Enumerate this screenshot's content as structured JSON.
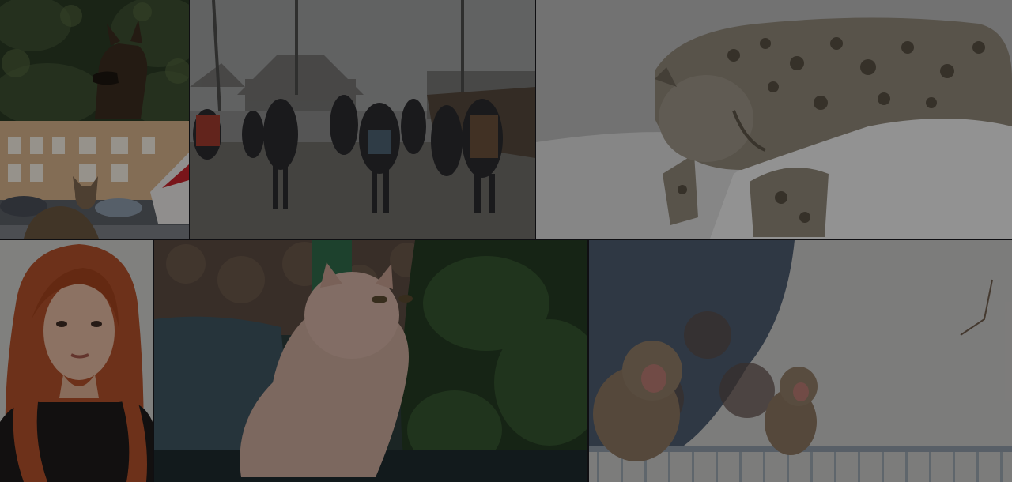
{
  "gallery": {
    "tiles": [
      {
        "id": "dog",
        "icon": "photo-dog-in-bushes"
      },
      {
        "id": "street-cat",
        "icon": "photo-cat-on-street"
      },
      {
        "id": "crowd",
        "icon": "photo-people-walking-in-rain"
      },
      {
        "id": "snow-leopard",
        "icon": "photo-snow-leopard"
      },
      {
        "id": "woman",
        "icon": "photo-red-haired-woman"
      },
      {
        "id": "persian-cat",
        "icon": "photo-persian-cat"
      },
      {
        "id": "monkeys",
        "icon": "photo-snow-monkeys-on-rail"
      }
    ]
  },
  "colors": {
    "background": "#0f0f12",
    "overlay": "rgba(0,0,0,0.38)"
  }
}
